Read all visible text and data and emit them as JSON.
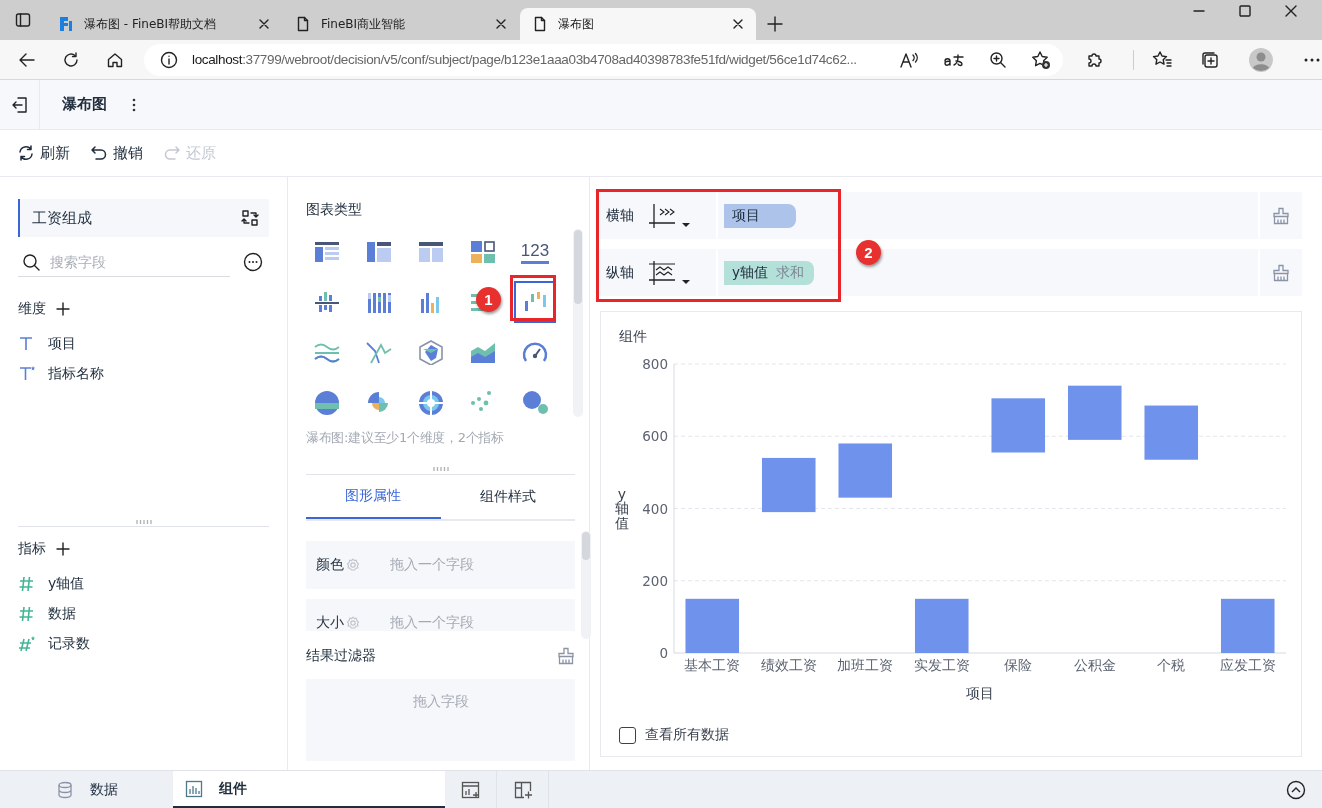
{
  "browser": {
    "tabs": [
      {
        "title": "瀑布图 - FineBI帮助文档",
        "kind": "brand",
        "selected": false
      },
      {
        "title": "FineBI商业智能",
        "kind": "page",
        "selected": false
      },
      {
        "title": "瀑布图",
        "kind": "page",
        "selected": true
      }
    ],
    "address": {
      "host": "localhost",
      "path": ":37799/webroot/decision/v5/conf/subject/page/b123e1aaa03b4708ad40398783fe51fd/widget/56ce1d74c62..."
    }
  },
  "app": {
    "title": "瀑布图",
    "toolbar": [
      {
        "label": "刷新",
        "kind": "refresh",
        "disabled": false
      },
      {
        "label": "撤销",
        "kind": "undo",
        "disabled": false
      },
      {
        "label": "还原",
        "kind": "redo",
        "disabled": true
      }
    ]
  },
  "left_panel": {
    "dataset": "工资组成",
    "search": {
      "placeholder": "搜索字段"
    },
    "dimensions": {
      "title": "维度",
      "fields": [
        {
          "label": "项目",
          "kind": "text"
        },
        {
          "label": "指标名称",
          "kind": "text_calc"
        }
      ]
    },
    "measures": {
      "title": "指标",
      "fields": [
        {
          "label": "y轴值",
          "kind": "number"
        },
        {
          "label": "数据",
          "kind": "number"
        },
        {
          "label": "记录数",
          "kind": "number_calc"
        }
      ]
    }
  },
  "chart_panel": {
    "title": "图表类型",
    "chart_types": [
      {
        "kind": "group_table",
        "selected": false
      },
      {
        "kind": "cross_table",
        "selected": false
      },
      {
        "kind": "detail_table",
        "selected": false
      },
      {
        "kind": "kpi",
        "selected": false
      },
      {
        "kind": "number",
        "label": "123",
        "selected": false
      },
      {
        "kind": "bar_center",
        "selected": false
      },
      {
        "kind": "bar_grouped",
        "selected": false
      },
      {
        "kind": "bar",
        "selected": false
      },
      {
        "kind": "bar_horizontal",
        "selected": false
      },
      {
        "kind": "waterfall",
        "selected": true
      },
      {
        "kind": "line_wave",
        "selected": false
      },
      {
        "kind": "line",
        "selected": false
      },
      {
        "kind": "radar",
        "selected": false
      },
      {
        "kind": "area",
        "selected": false
      },
      {
        "kind": "gauge",
        "selected": false
      },
      {
        "kind": "pie",
        "selected": false
      },
      {
        "kind": "rose",
        "selected": false
      },
      {
        "kind": "sunburst",
        "selected": false
      },
      {
        "kind": "scatter",
        "selected": false
      },
      {
        "kind": "bubble",
        "selected": false
      }
    ],
    "hint": "瀑布图:建议至少1个维度，2个指标",
    "tabs": [
      {
        "label": "图形属性",
        "selected": true
      },
      {
        "label": "组件样式",
        "selected": false
      }
    ],
    "properties": [
      {
        "label": "颜色",
        "placeholder": "拖入一个字段"
      },
      {
        "label": "大小",
        "placeholder": "拖入一个字段"
      }
    ],
    "filter": {
      "title": "结果过滤器",
      "placeholder": "拖入字段"
    }
  },
  "axes": [
    {
      "label": "横轴",
      "kind": "x",
      "field": "项目",
      "color": "#adc3ea"
    },
    {
      "label": "纵轴",
      "kind": "y",
      "field": "y轴值",
      "aggregation": "求和",
      "color": "#b3e0d8"
    }
  ],
  "annotations": [
    {
      "label": "1"
    },
    {
      "label": "2"
    }
  ],
  "widget": {
    "title": "组件",
    "chart_data": {
      "type": "bar",
      "grid": true,
      "xlabel": "项目",
      "ylabel": "y轴值",
      "categories": [
        "基本工资",
        "绩效工资",
        "加班工资",
        "实发工资",
        "保险",
        "公积金",
        "个税",
        "应发工资"
      ],
      "series": [
        {
          "color": "#6f92ec",
          "base": [
            0,
            390,
            430,
            0,
            555,
            590,
            535,
            0
          ],
          "values": [
            150,
            150,
            150,
            150,
            150,
            150,
            150,
            150
          ]
        }
      ],
      "ylim": [
        0,
        800
      ],
      "yticks": [
        0,
        200,
        400,
        600,
        800
      ]
    },
    "checkbox": {
      "label": "查看所有数据",
      "checked": false
    }
  },
  "bottom_tabs": [
    {
      "label": "数据",
      "kind": "data",
      "selected": false
    },
    {
      "label": "组件",
      "kind": "widget",
      "selected": true
    }
  ]
}
